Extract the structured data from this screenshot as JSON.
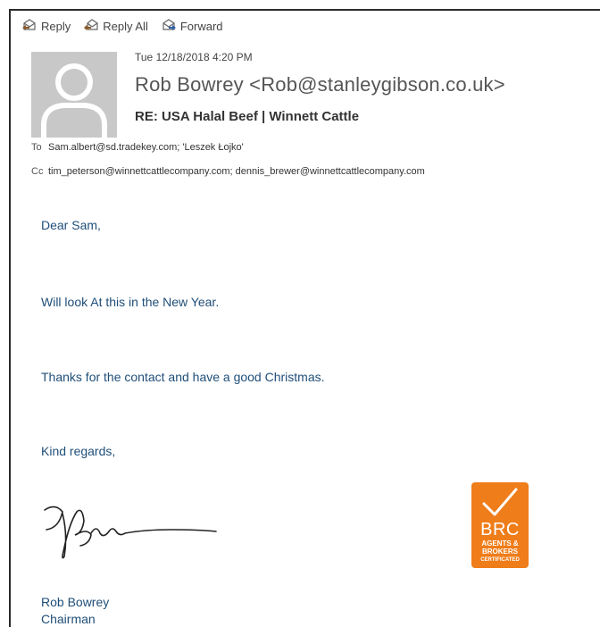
{
  "toolbar": {
    "reply_label": "Reply",
    "reply_all_label": "Reply All",
    "forward_label": "Forward"
  },
  "message": {
    "date": "Tue 12/18/2018 4:20 PM",
    "from": "Rob Bowrey <Rob@stanleygibson.co.uk>",
    "subject": "RE: USA Halal Beef | Winnett Cattle",
    "to_label": "To",
    "to_value": "Sam.albert@sd.tradekey.com; 'Leszek Łojko'",
    "cc_label": "Cc",
    "cc_value": "tim_peterson@winnettcattlecompany.com; dennis_brewer@winnettcattlecompany.com"
  },
  "body": {
    "greeting": "Dear Sam,",
    "line1": "Will look At this in the New Year.",
    "line2": "Thanks for the contact and have a good Christmas.",
    "closing": "Kind regards,"
  },
  "signature": {
    "name": "Rob Bowrey",
    "title": "Chairman"
  },
  "logo": {
    "brand": "BRC",
    "line1": "AGENTS &",
    "line2": "BROKERS",
    "line3": "CERTIFICATED",
    "color": "#ef7d1a"
  },
  "colors": {
    "body_text": "#1f4e79",
    "avatar_bg": "#c8c8c8"
  },
  "icons": {
    "reply": "reply-icon",
    "reply_all": "reply-all-icon",
    "forward": "forward-icon",
    "avatar": "person-silhouette-icon",
    "checkmark": "checkmark-icon"
  }
}
